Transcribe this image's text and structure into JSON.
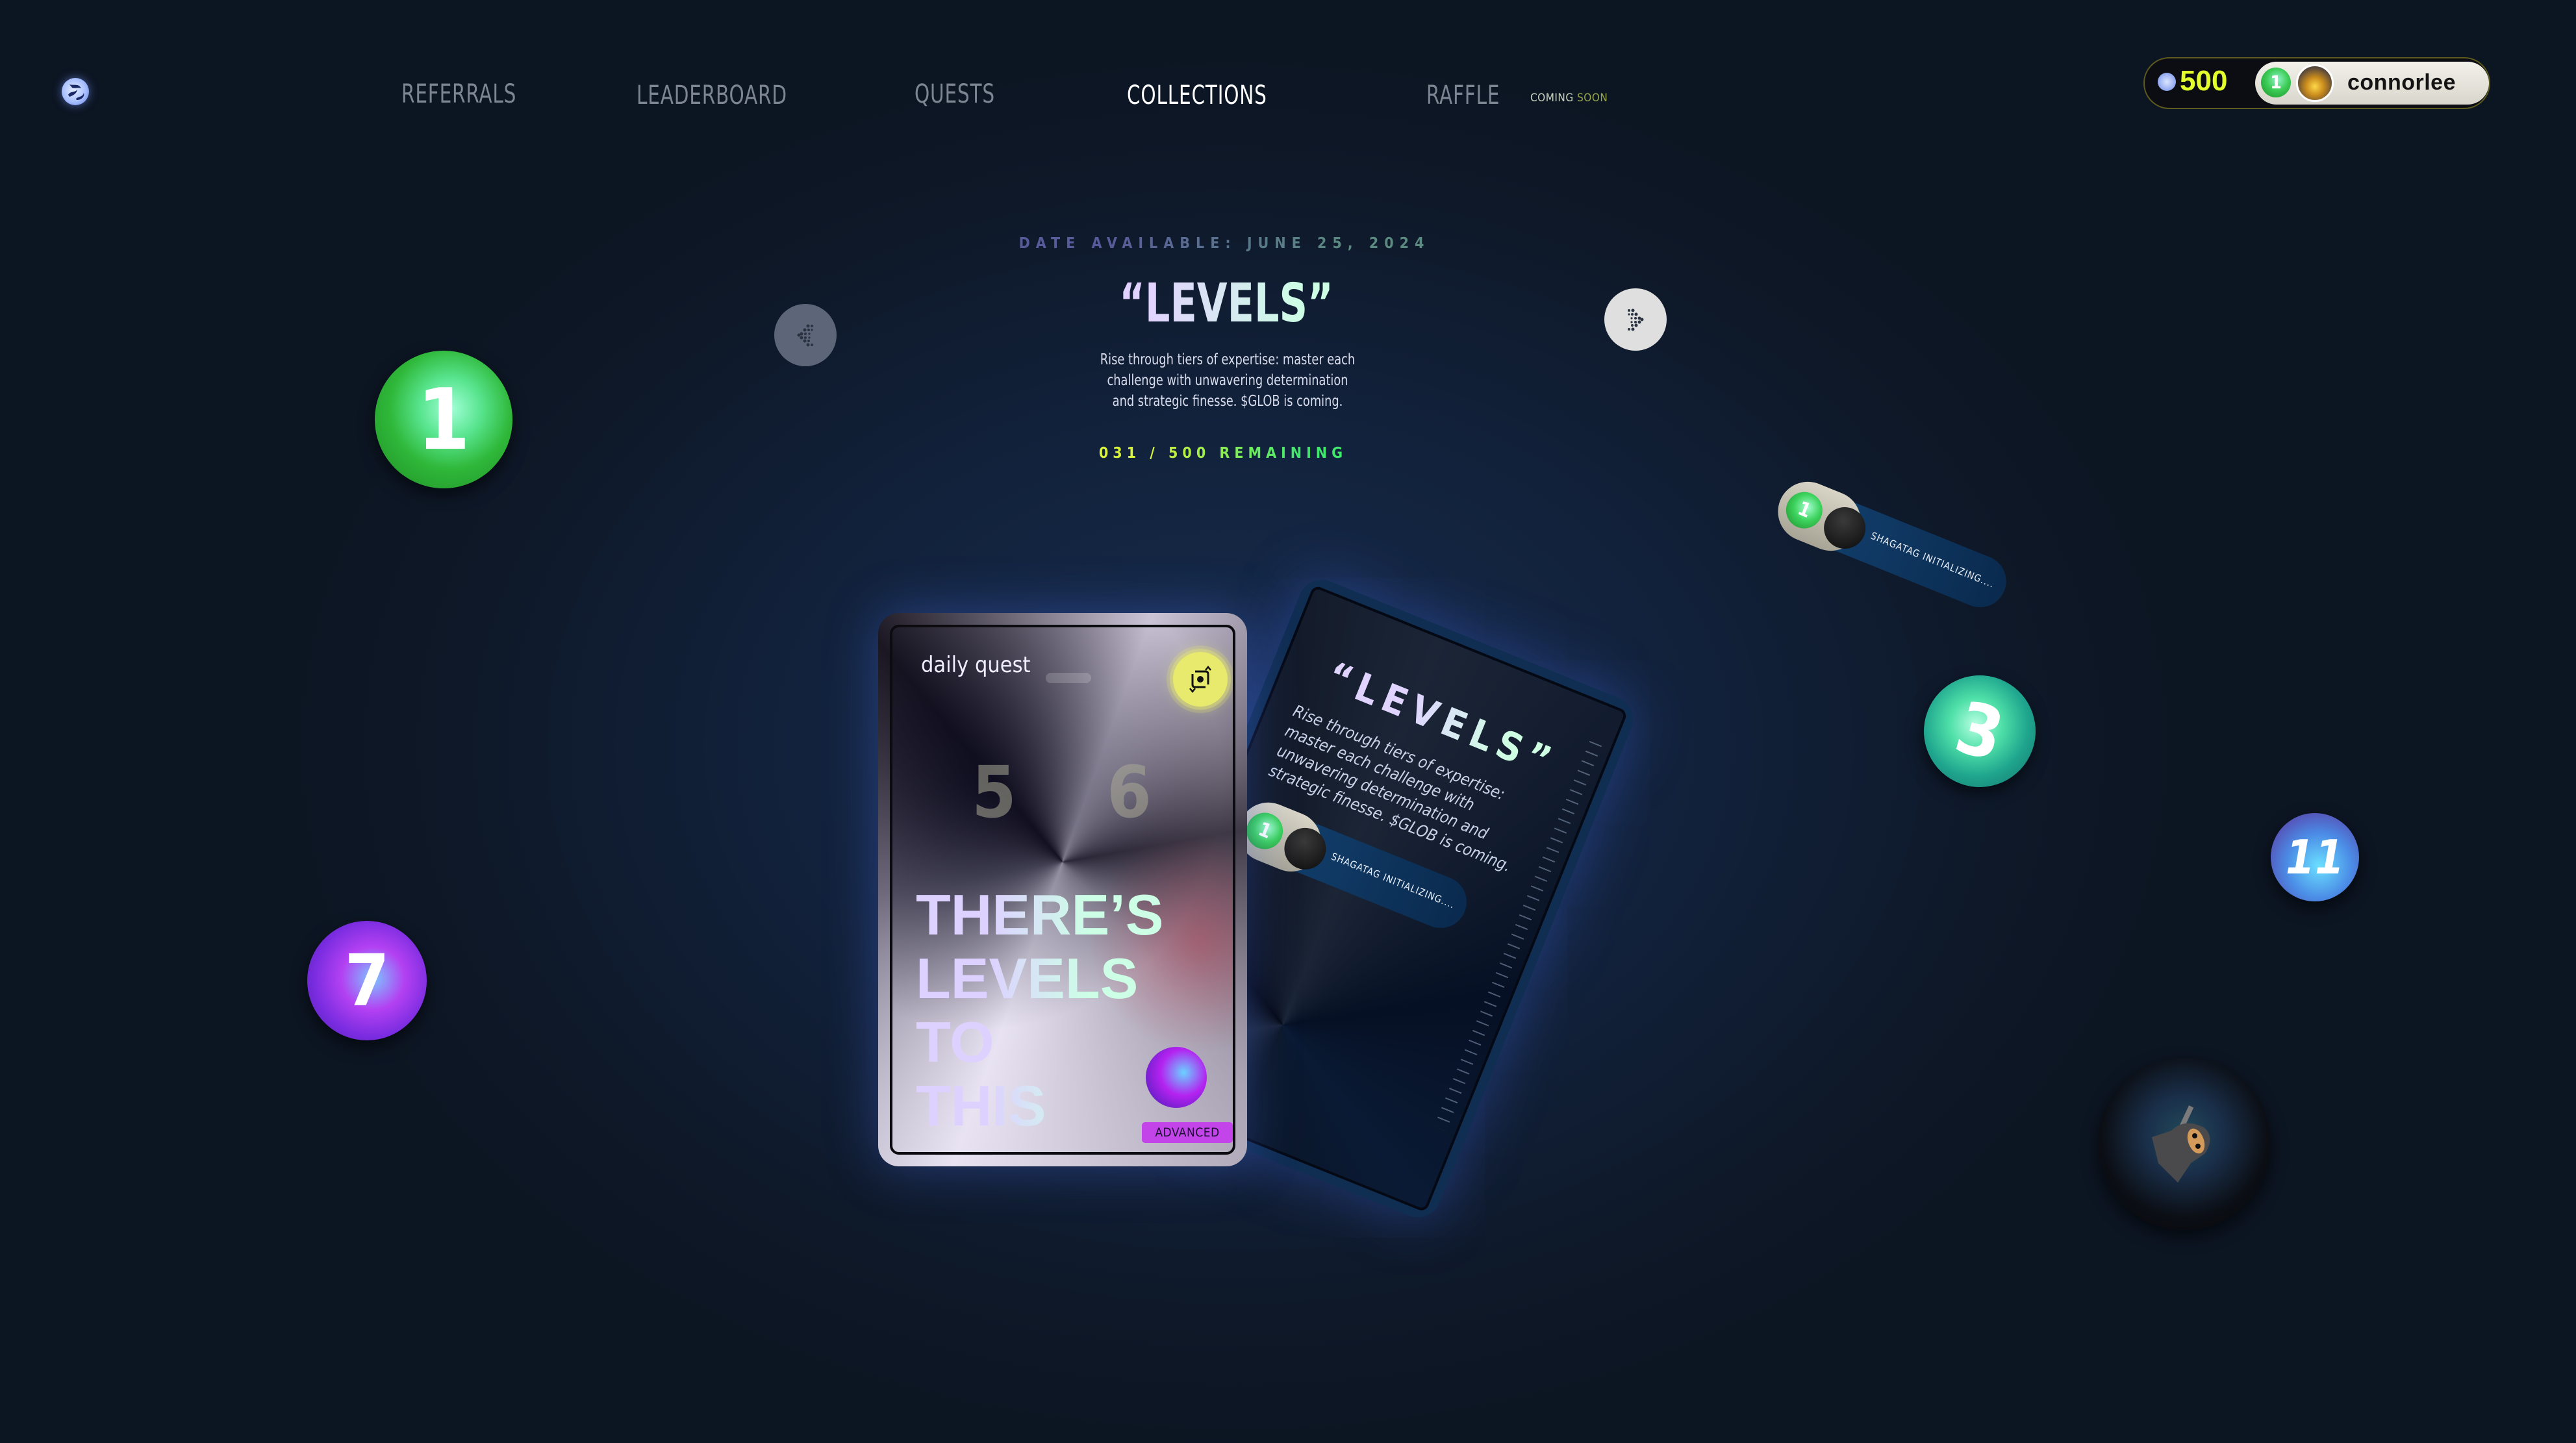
{
  "nav": {
    "logo": "globe-logo",
    "items": [
      {
        "label": "REFERRALS",
        "active": false
      },
      {
        "label": "LEADERBOARD",
        "active": false
      },
      {
        "label": "QUESTS",
        "active": false
      },
      {
        "label": "COLLECTIONS",
        "active": true
      },
      {
        "label": "RAFFLE",
        "active": false
      }
    ],
    "raffle_badge": {
      "coming": "COMING",
      "soon": "SOON"
    }
  },
  "user": {
    "points": "500",
    "level": "1",
    "username": "connorlee"
  },
  "hero": {
    "date_available": "DATE AVAILABLE: JUNE 25, 2024",
    "title": "“LEVELS”",
    "description": "Rise through tiers of expertise: master each challenge with unwavering determination and strategic finesse. $GLOB is coming.",
    "remaining": "031 / 500 REMAINING",
    "prev_label": "previous",
    "next_label": "next"
  },
  "decor_balls": [
    {
      "label": "1",
      "color": "#2fb83a"
    },
    {
      "label": "7",
      "color": "#7a2ce0"
    },
    {
      "label": "3",
      "color": "#1fa58e"
    },
    {
      "label": "11",
      "color": "#4b8ce6"
    },
    {
      "label": "ninja",
      "color": "#0b0e14"
    }
  ],
  "card_front": {
    "label": "daily quest",
    "bg_numbers": [
      "5",
      "6"
    ],
    "headline": [
      "THERE’S",
      "LEVELS",
      "TO",
      "THIS"
    ],
    "badge": "ADVANCED",
    "badge_color": "#c345ea",
    "sync_color": "#e7ea6c"
  },
  "card_back": {
    "title": "“LEVELS”",
    "description": "Rise through tiers of expertise: master each challenge with unwavering determination and strategic finesse. $GLOB is coming.",
    "toggle": {
      "level": "1",
      "label": "SHAGATAG INITIALIZING...."
    }
  },
  "floating_toggle": {
    "level": "1",
    "label": "SHAGATAG INITIALIZING...."
  }
}
